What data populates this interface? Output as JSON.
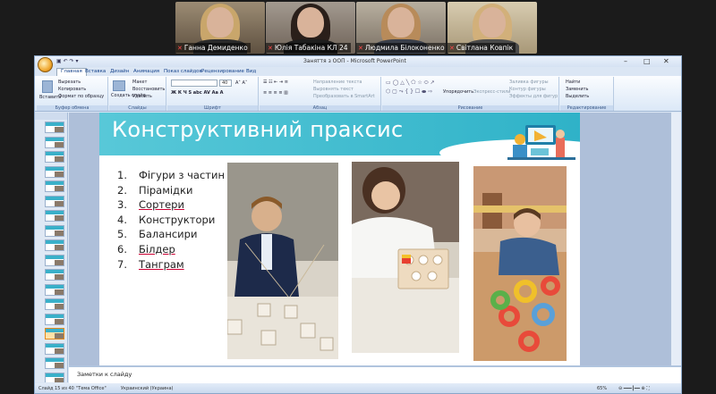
{
  "participants": [
    {
      "name": "Ганна Демиденко",
      "bg": "#7a6b5a"
    },
    {
      "name": "Юлія Табакіна КЛ 24",
      "bg": "#8a7e74"
    },
    {
      "name": "Людмила Білоконенко",
      "bg": "#8c8478"
    },
    {
      "name": "Світлана Ковпік",
      "bg": "#b7a88c"
    }
  ],
  "window": {
    "title": "Заняття з ООП - Microsoft PowerPoint"
  },
  "ribbon": {
    "tabs": [
      "Главная",
      "Вставка",
      "Дизайн",
      "Анимация",
      "Показ слайдов",
      "Рецензирование",
      "Вид"
    ],
    "active_tab": "Главная",
    "clipboard": {
      "paste": "Вставить",
      "cut": "Вырезать",
      "copy": "Копировать",
      "format": "Формат по образцу",
      "label": "Буфер обмена"
    },
    "slides": {
      "new": "Создать слайд",
      "layout": "Макет",
      "reset": "Восстановить",
      "delete": "Удалить",
      "label": "Слайды"
    },
    "font": {
      "label": "Шрифт",
      "size": "40"
    },
    "paragraph": {
      "dir": "Направление текста",
      "align": "Выровнять текст",
      "smartart": "Преобразовать в SmartArt",
      "label": "Абзац"
    },
    "drawing": {
      "arrange": "Упорядочить",
      "styles": "Экспресс-стили",
      "fill": "Заливка фигуры",
      "outline": "Контур фигуры",
      "effects": "Эффекты для фигур",
      "label": "Рисование"
    },
    "editing": {
      "find": "Найти",
      "replace": "Заменить",
      "select": "Выделить",
      "label": "Редактирование"
    }
  },
  "slide": {
    "title": "Конструктивний праксис",
    "items": [
      {
        "n": "1.",
        "text": "Фігури з частин"
      },
      {
        "n": "2.",
        "text": "Пірамідки"
      },
      {
        "n": "3.",
        "text": "Сортери"
      },
      {
        "n": "4.",
        "text": "Конструктори"
      },
      {
        "n": "5.",
        "text": "Балансири"
      },
      {
        "n": "6.",
        "text": "Білдер"
      },
      {
        "n": "7.",
        "text": "Танграм"
      }
    ]
  },
  "notes_placeholder": "Заметки к слайду",
  "status": {
    "slide": "Слайд 15 из 40",
    "theme": "\"Тема Office\"",
    "lang": "Украинский (Украина)",
    "zoom": "65%"
  }
}
